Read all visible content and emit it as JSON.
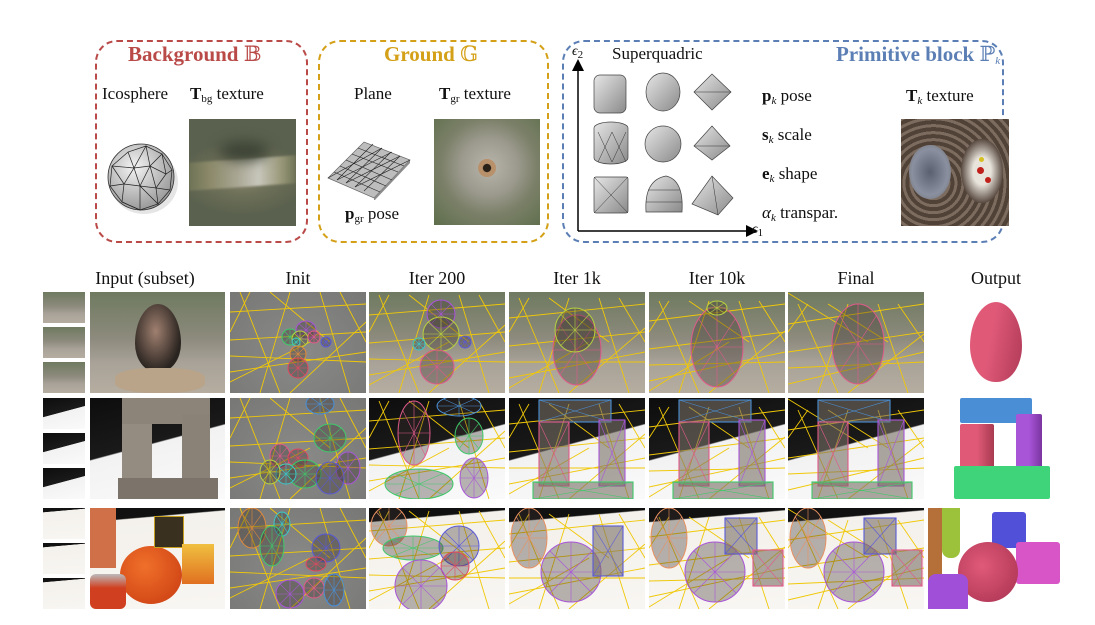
{
  "figure": {
    "panels": {
      "background": {
        "title": "Background",
        "symbol": "𝔹",
        "color": "#b94a48",
        "geometry_label": "Icosphere",
        "texture_symbol": "T",
        "texture_sub": "bg",
        "texture_label": "texture"
      },
      "ground": {
        "title": "Ground",
        "symbol": "𝔾",
        "color": "#d4a017",
        "geometry_label": "Plane",
        "texture_symbol": "T",
        "texture_sub": "gr",
        "texture_label": "texture",
        "pose_symbol": "p",
        "pose_sub": "gr",
        "pose_label": "pose"
      },
      "primitive": {
        "title": "Primitive block",
        "symbol": "ℙ",
        "symbol_sub": "k",
        "color": "#5b7fb5",
        "superquadric_label": "Superquadric",
        "axis_y": "ϵ",
        "axis_y_sub": "2",
        "axis_x": "ϵ",
        "axis_x_sub": "1",
        "params": [
          {
            "symbol": "p",
            "sub": "k",
            "label": "pose",
            "bold": true
          },
          {
            "symbol": "s",
            "sub": "k",
            "label": "scale",
            "bold": true
          },
          {
            "symbol": "e",
            "sub": "k",
            "label": "shape",
            "bold": true
          },
          {
            "symbol": "α",
            "sub": "k",
            "label": "transpar.",
            "bold": false
          }
        ],
        "texture_symbol": "T",
        "texture_sub": "k",
        "texture_label": "texture"
      }
    },
    "columns": [
      "Input (subset)",
      "Init",
      "Iter 200",
      "Iter 1k",
      "Iter 10k",
      "Final",
      "Output"
    ],
    "rows": [
      {
        "scene": "egg",
        "wire_color": "#e05a8a",
        "output_colors": [
          "#e05a78"
        ]
      },
      {
        "scene": "stone-arch",
        "wire_colors": [
          "#4a8fd6",
          "#e05a78",
          "#a855d8",
          "#3fc96a"
        ],
        "output_colors": [
          "#4a8fd6",
          "#e05a78",
          "#a855d8",
          "#3fd47a"
        ]
      },
      {
        "scene": "pumpkin",
        "wire_colors": [
          "#a855d8",
          "#5a5ad6",
          "#e05a78"
        ],
        "output_colors": [
          "#b5703a",
          "#9bc23a",
          "#e05a78",
          "#5050d8",
          "#d855c8",
          "#a050d8"
        ]
      }
    ],
    "wire_ground_color": "#f0c808"
  }
}
